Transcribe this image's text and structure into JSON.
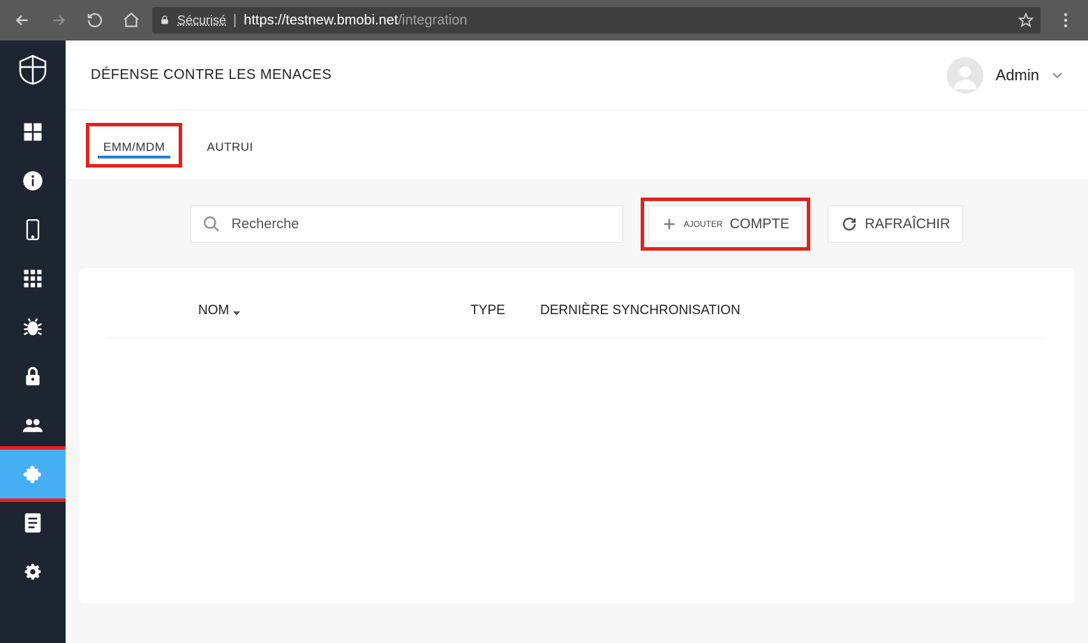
{
  "browser": {
    "secure_label": "Sécurisé",
    "url_base": "https://testnew.bmobi.net",
    "url_path": "/integration"
  },
  "header": {
    "title": "DÉFENSE CONTRE LES MENACES",
    "user_name": "Admin"
  },
  "tabs": {
    "active": "EMM/MDM",
    "other": "AUTRUI"
  },
  "toolbar": {
    "search_placeholder": "Recherche",
    "add_small_label": "AJOUTER",
    "add_label": "COMPTE",
    "refresh_label": "RAFRAÎCHIR"
  },
  "table": {
    "col_nom": "NOM",
    "col_type": "TYPE",
    "col_sync": "DERNIÈRE SYNCHRONISATION"
  },
  "sidebar": {
    "items": [
      {
        "name": "dashboard"
      },
      {
        "name": "info"
      },
      {
        "name": "device"
      },
      {
        "name": "apps"
      },
      {
        "name": "bug"
      },
      {
        "name": "lock"
      },
      {
        "name": "users"
      },
      {
        "name": "integration",
        "active": true
      },
      {
        "name": "document"
      },
      {
        "name": "settings"
      }
    ]
  }
}
